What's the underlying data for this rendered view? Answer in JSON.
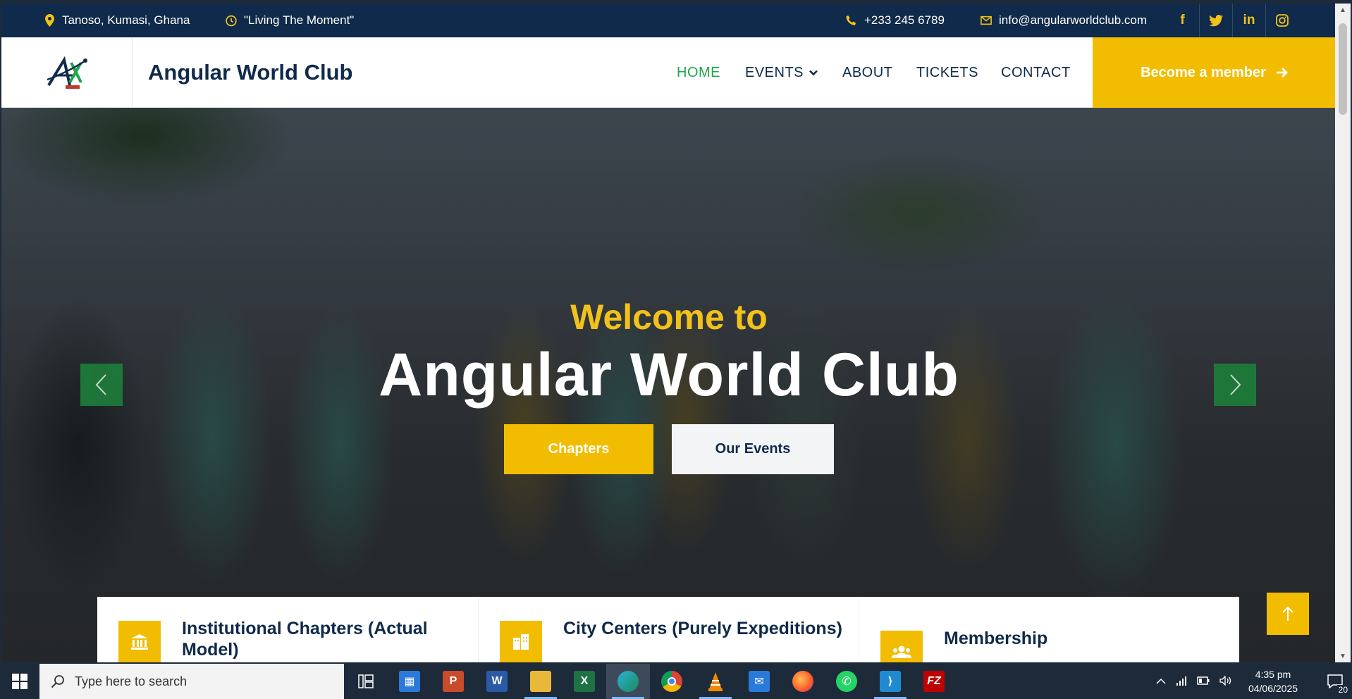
{
  "topbar": {
    "location": "Tanoso, Kumasi, Ghana",
    "motto": "\"Living The Moment\"",
    "phone": "+233 245 6789",
    "email": "info@angularworldclub.com",
    "social": [
      "f",
      "twitter",
      "in",
      "instagram"
    ]
  },
  "nav": {
    "brand": "Angular World Club",
    "items": [
      {
        "label": "HOME",
        "active": true
      },
      {
        "label": "EVENTS",
        "active": false
      },
      {
        "label": "ABOUT",
        "active": false
      },
      {
        "label": "TICKETS",
        "active": false
      },
      {
        "label": "CONTACT",
        "active": false
      }
    ],
    "member_button": "Become a member"
  },
  "hero": {
    "subtitle": "Welcome to",
    "title": "Angular World Club",
    "primary_button": "Chapters",
    "secondary_button": "Our Events"
  },
  "cards": [
    {
      "title": "Institutional Chapters (Actual Model)",
      "icon": "institution-icon"
    },
    {
      "title": "City Centers (Purely Expeditions)",
      "icon": "city-icon"
    },
    {
      "title": "Membership",
      "icon": "users-icon"
    }
  ],
  "taskbar": {
    "search_placeholder": "Type here to search",
    "time": "4:35 pm",
    "date": "04/06/2025",
    "notifications": "20"
  },
  "colors": {
    "navy": "#0f2a4a",
    "accent": "#f2bd00",
    "green": "#1fa54a"
  }
}
